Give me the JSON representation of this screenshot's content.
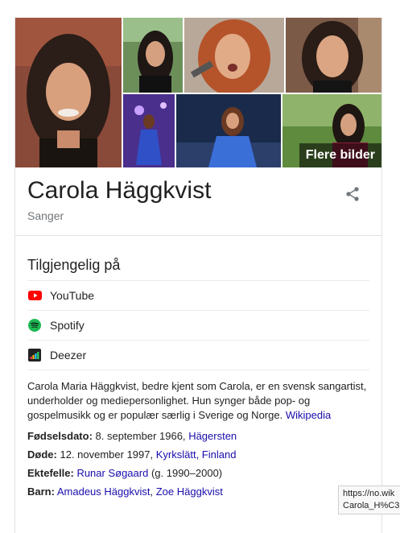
{
  "gallery": {
    "more_images_label": "Flere bilder"
  },
  "entity": {
    "name": "Carola Häggkvist",
    "type": "Sanger"
  },
  "available_on": {
    "heading": "Tilgjengelig på",
    "services": [
      {
        "label": "YouTube",
        "icon": "youtube-icon"
      },
      {
        "label": "Spotify",
        "icon": "spotify-icon"
      },
      {
        "label": "Deezer",
        "icon": "deezer-icon"
      }
    ]
  },
  "description": {
    "text": "Carola Maria Häggkvist, bedre kjent som Carola, er en svensk sangartist, underholder og mediepersonlighet. Hun synger både pop- og gospelmusikk og er populær særlig i Sverige og Norge.",
    "source_link": "Wikipedia"
  },
  "facts": {
    "born_label": "Fødselsdato:",
    "born_value": "8. september 1966,",
    "born_place": "Hägersten",
    "died_label": "Døde:",
    "died_value": "12. november 1997,",
    "died_place": "Kyrkslätt, Finland",
    "spouse_label": "Ektefelle:",
    "spouse_link": "Runar Søgaard",
    "spouse_years": "(g. 1990–2000)",
    "children_label": "Barn:",
    "child_1": "Amadeus Häggkvist",
    "child_sep": ",",
    "child_2": "Zoe Häggkvist"
  },
  "status_tooltip": {
    "line1": "https://no.wik",
    "line2": "Carola_H%C3"
  },
  "colors": {
    "link": "#1a0dab",
    "youtube": "#ff0000",
    "spotify": "#1db954",
    "deezer": "#222222"
  }
}
